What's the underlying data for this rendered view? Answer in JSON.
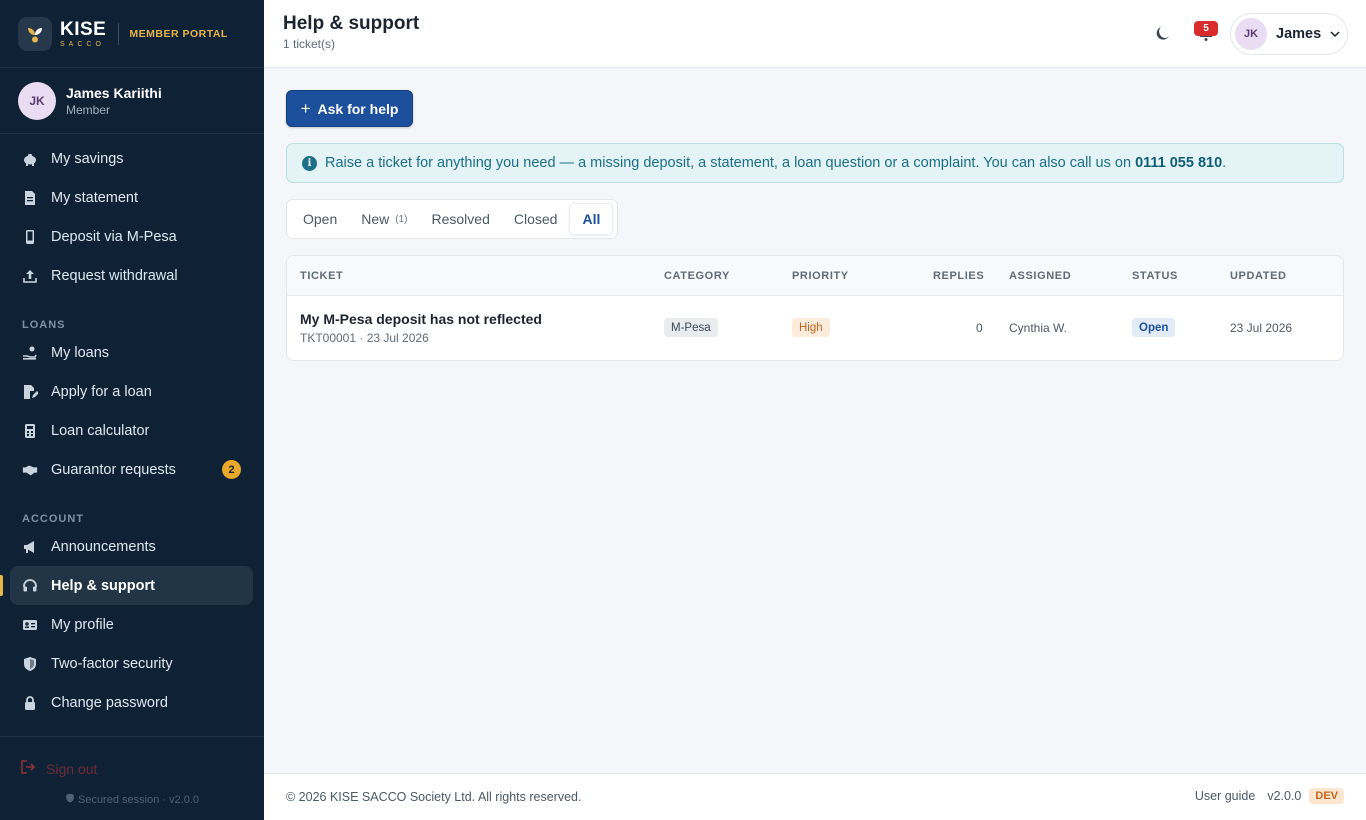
{
  "brand": {
    "name": "KISE",
    "sub": "SACCO",
    "portal_label": "MEMBER PORTAL"
  },
  "user": {
    "initials": "JK",
    "name": "James Kariithi",
    "role": "Member",
    "short_name": "James"
  },
  "nav": {
    "main": [
      {
        "label": "My savings",
        "icon": "piggy-bank-icon"
      },
      {
        "label": "My statement",
        "icon": "document-icon"
      },
      {
        "label": "Deposit via M-Pesa",
        "icon": "phone-icon"
      },
      {
        "label": "Request withdrawal",
        "icon": "upload-icon"
      }
    ],
    "loans_heading": "LOANS",
    "loans": [
      {
        "label": "My loans",
        "icon": "hand-coins-icon"
      },
      {
        "label": "Apply for a loan",
        "icon": "edit-document-icon"
      },
      {
        "label": "Loan calculator",
        "icon": "calculator-icon"
      },
      {
        "label": "Guarantor requests",
        "icon": "handshake-icon",
        "badge": "2"
      }
    ],
    "account_heading": "ACCOUNT",
    "account": [
      {
        "label": "Announcements",
        "icon": "megaphone-icon"
      },
      {
        "label": "Help & support",
        "icon": "headset-icon",
        "active": true
      },
      {
        "label": "My profile",
        "icon": "id-card-icon"
      },
      {
        "label": "Two-factor security",
        "icon": "shield-icon"
      },
      {
        "label": "Change password",
        "icon": "lock-icon"
      }
    ],
    "sign_out": "Sign out",
    "secured": "Secured session · v2.0.0"
  },
  "header": {
    "title": "Help & support",
    "subtitle": "1 ticket(s)",
    "notification_count": "5"
  },
  "main": {
    "ask_button": "Ask for help",
    "banner_text": "Raise a ticket for anything you need — a missing deposit, a statement, a loan question or a complaint. You can also call us on ",
    "banner_phone": "0111 055 810",
    "banner_end": ".",
    "tabs": [
      {
        "label": "Open"
      },
      {
        "label": "New",
        "count": "(1)"
      },
      {
        "label": "Resolved"
      },
      {
        "label": "Closed"
      },
      {
        "label": "All",
        "active": true
      }
    ],
    "table": {
      "headers": [
        "TICKET",
        "CATEGORY",
        "PRIORITY",
        "REPLIES",
        "ASSIGNED",
        "STATUS",
        "UPDATED"
      ],
      "rows": [
        {
          "title": "My M-Pesa deposit has not reflected",
          "meta": "TKT00001 · 23 Jul 2026",
          "category": "M-Pesa",
          "priority": "High",
          "replies": "0",
          "assigned": "Cynthia W.",
          "status": "Open",
          "updated": "23 Jul 2026"
        }
      ]
    }
  },
  "footer": {
    "copyright": "© 2026 KISE SACCO Society Ltd. All rights reserved.",
    "guide": "User guide",
    "version": "v2.0.0",
    "env": "DEV"
  },
  "colors": {
    "sidebar": "#0f2235",
    "accent": "#e8b54a",
    "primary": "#1c4f9c",
    "danger": "#d92d2d"
  }
}
